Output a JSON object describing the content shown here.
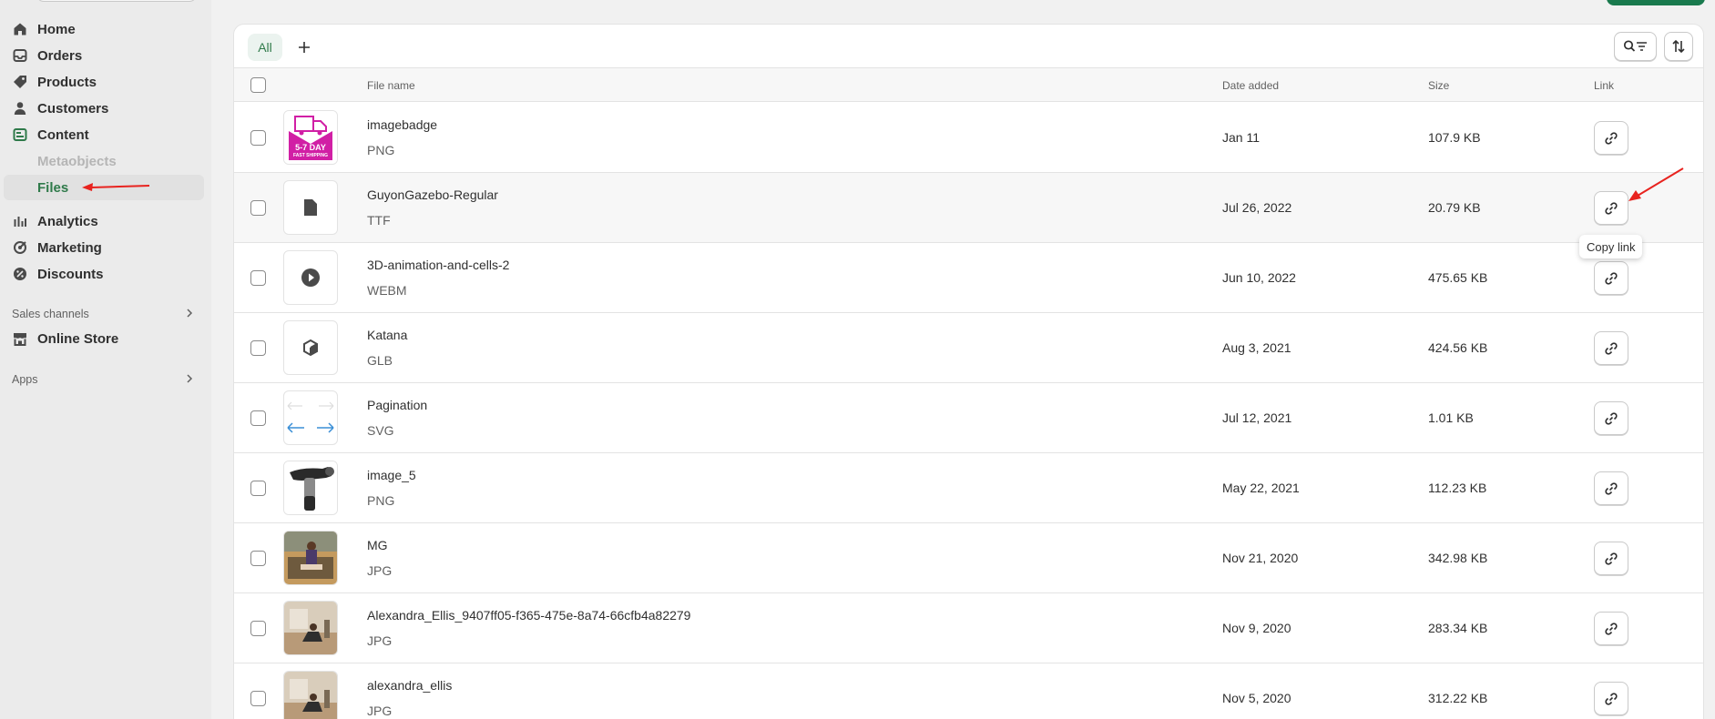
{
  "sidebar": {
    "nav": [
      {
        "label": "Home",
        "icon": "home-icon"
      },
      {
        "label": "Orders",
        "icon": "inbox-icon"
      },
      {
        "label": "Products",
        "icon": "tag-icon"
      },
      {
        "label": "Customers",
        "icon": "person-icon"
      },
      {
        "label": "Content",
        "icon": "content-icon"
      }
    ],
    "sub": [
      {
        "label": "Metaobjects"
      },
      {
        "label": "Files"
      }
    ],
    "nav2": [
      {
        "label": "Analytics",
        "icon": "bar-chart-icon"
      },
      {
        "label": "Marketing",
        "icon": "target-icon"
      },
      {
        "label": "Discounts",
        "icon": "discount-icon"
      }
    ],
    "sales_channels_title": "Sales channels",
    "online_store": "Online Store",
    "apps_title": "Apps"
  },
  "tabs": {
    "all": "All",
    "add": "+"
  },
  "table": {
    "headers": {
      "file_name": "File name",
      "date_added": "Date added",
      "size": "Size",
      "link": "Link"
    },
    "rows": [
      {
        "name": "imagebadge",
        "type": "PNG",
        "date": "Jan 11",
        "size": "107.9 KB",
        "thumb": "badge"
      },
      {
        "name": "GuyonGazebo-Regular",
        "type": "TTF",
        "date": "Jul 26, 2022",
        "size": "20.79 KB",
        "thumb": "file"
      },
      {
        "name": "3D-animation-and-cells-2",
        "type": "WEBM",
        "date": "Jun 10, 2022",
        "size": "475.65 KB",
        "thumb": "play"
      },
      {
        "name": "Katana",
        "type": "GLB",
        "date": "Aug 3, 2021",
        "size": "424.56 KB",
        "thumb": "cube"
      },
      {
        "name": "Pagination",
        "type": "SVG",
        "date": "Jul 12, 2021",
        "size": "1.01 KB",
        "thumb": "arrows"
      },
      {
        "name": "image_5",
        "type": "PNG",
        "date": "May 22, 2021",
        "size": "112.23 KB",
        "thumb": "massager"
      },
      {
        "name": "MG",
        "type": "JPG",
        "date": "Nov 21, 2020",
        "size": "342.98 KB",
        "thumb": "photo1"
      },
      {
        "name": "Alexandra_Ellis_9407ff05-f365-475e-8a74-66cfb4a82279",
        "type": "JPG",
        "date": "Nov 9, 2020",
        "size": "283.34 KB",
        "thumb": "photo2"
      },
      {
        "name": "alexandra_ellis",
        "type": "JPG",
        "date": "Nov 5, 2020",
        "size": "312.22 KB",
        "thumb": "photo2"
      }
    ]
  },
  "badge_text": {
    "line1": "5-7 DAY",
    "line2": "FAST SHIPPING"
  },
  "tooltip": "Copy link",
  "colors": {
    "accent": "#2f7a4a",
    "primary_button": "#1a7a4e",
    "annotation_arrow": "#e8231f"
  }
}
